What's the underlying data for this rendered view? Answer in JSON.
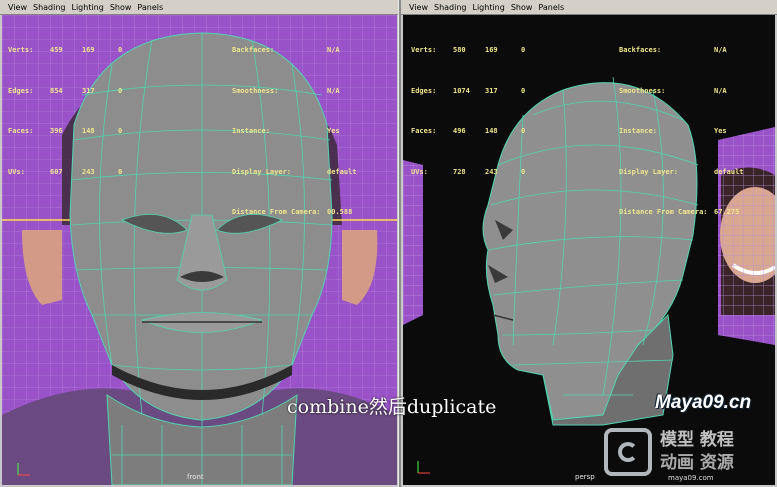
{
  "menu": [
    "View",
    "Shading",
    "Lighting",
    "Show",
    "Panels"
  ],
  "left": {
    "stats": [
      {
        "label": "Verts:",
        "a": "459",
        "b": "169",
        "c": "0"
      },
      {
        "label": "Edges:",
        "a": "854",
        "b": "317",
        "c": "0"
      },
      {
        "label": "Faces:",
        "a": "396",
        "b": "148",
        "c": "0"
      },
      {
        "label": "UVs:",
        "a": "607",
        "b": "243",
        "c": "0"
      }
    ],
    "info": [
      {
        "label": "Backfaces:",
        "value": "N/A"
      },
      {
        "label": "Smoothness:",
        "value": "N/A"
      },
      {
        "label": "Instance:",
        "value": "Yes"
      },
      {
        "label": "Display Layer:",
        "value": "default"
      },
      {
        "label": "Distance From Camera:",
        "value": "00.588"
      }
    ],
    "camera": "front"
  },
  "right": {
    "stats": [
      {
        "label": "Verts:",
        "a": "580",
        "b": "169",
        "c": "0"
      },
      {
        "label": "Edges:",
        "a": "1074",
        "b": "317",
        "c": "0"
      },
      {
        "label": "Faces:",
        "a": "496",
        "b": "148",
        "c": "0"
      },
      {
        "label": "UVs:",
        "a": "728",
        "b": "243",
        "c": "0"
      }
    ],
    "info": [
      {
        "label": "Backfaces:",
        "value": "N/A"
      },
      {
        "label": "Smoothness:",
        "value": "N/A"
      },
      {
        "label": "Instance:",
        "value": "Yes"
      },
      {
        "label": "Display Layer:",
        "value": "default"
      },
      {
        "label": "Distance From Camera:",
        "value": "67.275"
      }
    ],
    "camera": "persp"
  },
  "overlay_caption": "combine然后duplicate",
  "watermark": {
    "site": "Maya09.cn",
    "line1": "模型 教程",
    "line2": "动画 资源",
    "url": "maya09.com"
  },
  "colors": {
    "wire": "#4fd6b0",
    "mesh": "#8d8d8d",
    "bg_left": "#9a52c8",
    "bg_right": "#0b0b0b",
    "hud": "#f0e68c"
  }
}
